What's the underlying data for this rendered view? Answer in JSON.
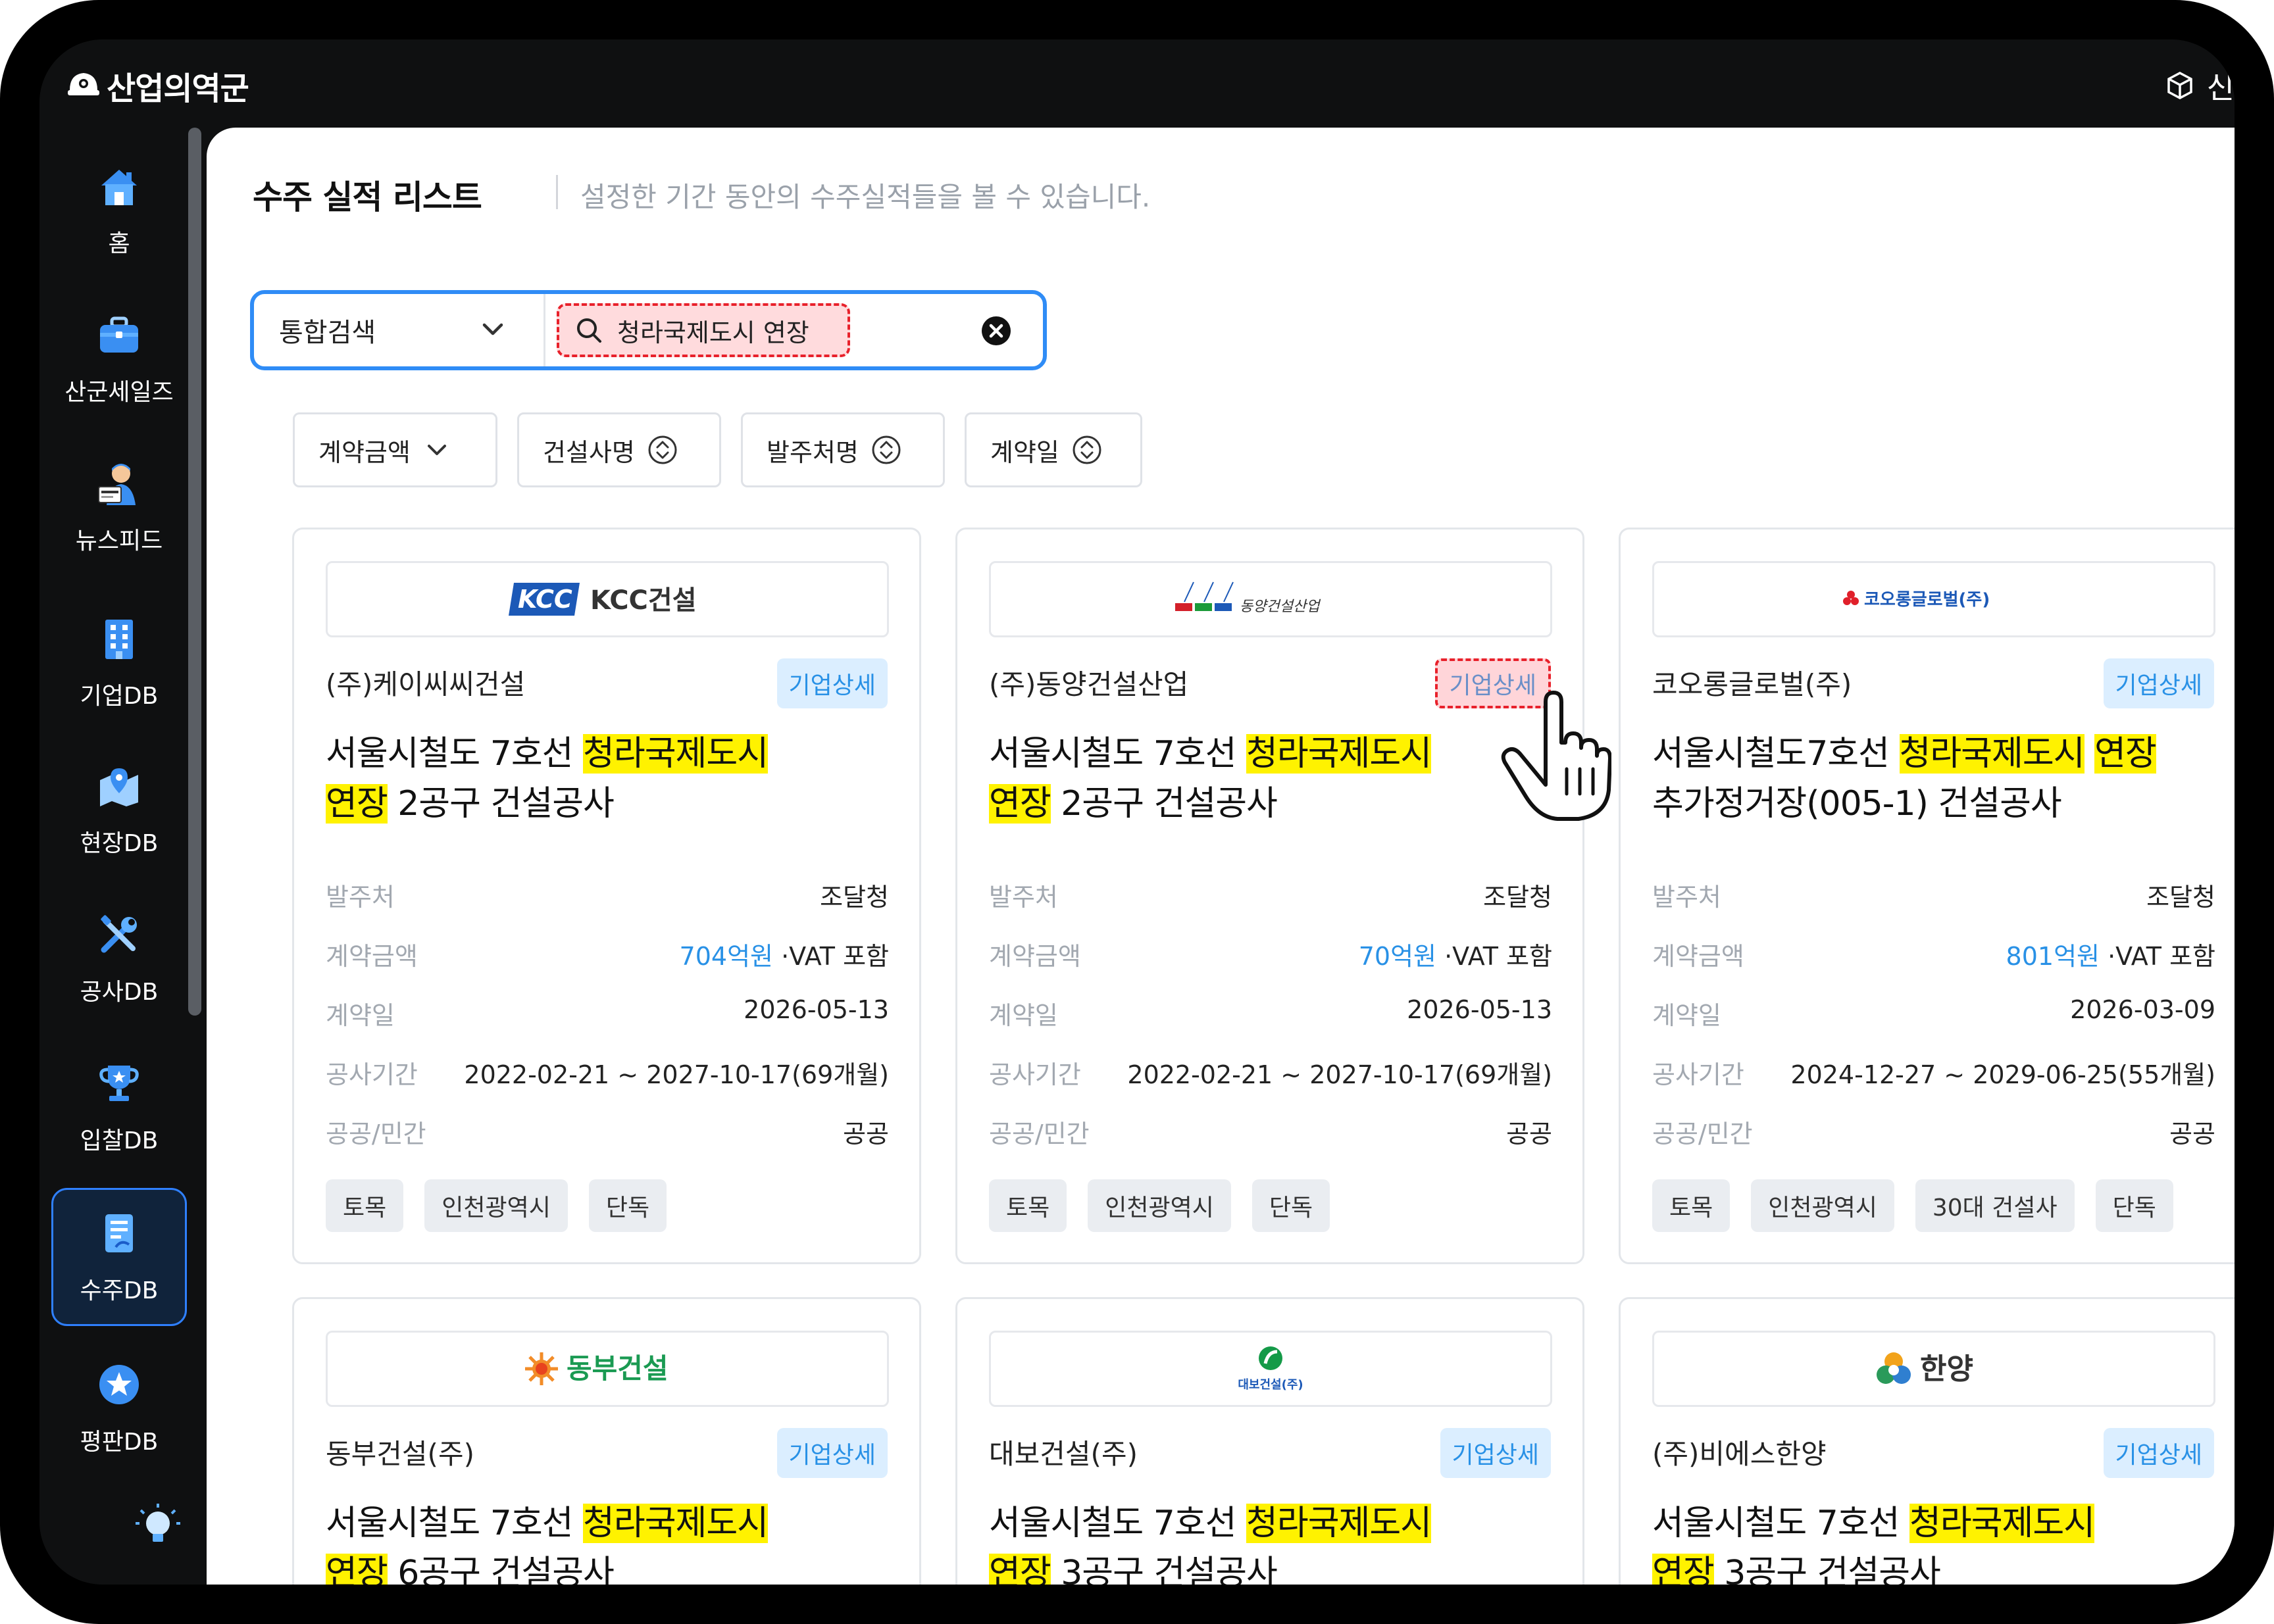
{
  "app": {
    "brand": "산업의역군",
    "top_right_label": "신"
  },
  "sidebar": {
    "items": [
      {
        "label": "홈"
      },
      {
        "label": "산군세일즈"
      },
      {
        "label": "뉴스피드"
      },
      {
        "label": "기업DB"
      },
      {
        "label": "현장DB"
      },
      {
        "label": "공사DB"
      },
      {
        "label": "입찰DB"
      },
      {
        "label": "수주DB",
        "active": true
      },
      {
        "label": "평판DB"
      }
    ]
  },
  "page": {
    "title": "수주 실적 리스트",
    "subtitle": "설정한 기간 동안의 수주실적들을 볼 수 있습니다."
  },
  "search": {
    "scope": "통합검색",
    "query": "청라국제도시 연장"
  },
  "filters": [
    {
      "label": "계약금액",
      "icon": "chevron-down-icon"
    },
    {
      "label": "건설사명",
      "icon": "sort-icon"
    },
    {
      "label": "발주처명",
      "icon": "sort-icon"
    },
    {
      "label": "계약일",
      "icon": "sort-icon"
    }
  ],
  "labels": {
    "client": "발주처",
    "amount": "계약금액",
    "date": "계약일",
    "period": "공사기간",
    "sector": "공공/민간",
    "detail": "기업상세",
    "vat": "·VAT 포함"
  },
  "cards": [
    {
      "logo_text": "KCC건설",
      "company": "(주)케이씨씨건설",
      "project_pre": "서울시철도 7호선 ",
      "project_hl1": "청라국제도시",
      "project_hl2": "연장",
      "project_post": " 2공구 건설공사",
      "client": "조달청",
      "amount": "704억원",
      "date": "2026-05-13",
      "period": "2022-02-21 ~ 2027-10-17(69개월)",
      "sector": "공공",
      "tags": [
        "토목",
        "인천광역시",
        "단독"
      ]
    },
    {
      "logo_text": "동양건설산업",
      "company": "(주)동양건설산업",
      "project_pre": "서울시철도 7호선 ",
      "project_hl1": "청라국제도시",
      "project_hl2": "연장",
      "project_post": " 2공구 건설공사",
      "client": "조달청",
      "amount": "70억원",
      "date": "2026-05-13",
      "period": "2022-02-21 ~ 2027-10-17(69개월)",
      "sector": "공공",
      "tags": [
        "토목",
        "인천광역시",
        "단독"
      ]
    },
    {
      "logo_text": "코오롱글로벌(주)",
      "company": "코오롱글로벌(주)",
      "project_pre": "서울시철도7호선 ",
      "project_hl1": "청라국제도시",
      "project_hl2": "연장",
      "project_post": "추가정거장(005-1) 건설공사",
      "client": "조달청",
      "amount": "801억원",
      "date": "2026-03-09",
      "period": "2024-12-27 ~ 2029-06-25(55개월)",
      "sector": "공공",
      "tags": [
        "토목",
        "인천광역시",
        "30대 건설사",
        "단독"
      ]
    },
    {
      "logo_text": "동부건설",
      "company": "동부건설(주)",
      "project_pre": "서울시철도 7호선 ",
      "project_hl1": "청라국제도시",
      "project_hl2": "연장",
      "project_post": " 6공구 건설공사"
    },
    {
      "logo_text": "대보건설(주)",
      "company": "대보건설(주)",
      "project_pre": "서울시철도 7호선 ",
      "project_hl1": "청라국제도시",
      "project_hl2": "연장",
      "project_post": " 3공구 건설공사"
    },
    {
      "logo_text": "한양",
      "company": "(주)비에스한양",
      "project_pre": "서울시철도 7호선 ",
      "project_hl1": "청라국제도시",
      "project_hl2": "연장",
      "project_post": " 3공구 건설공사"
    }
  ],
  "colors": {
    "accent": "#2f8cf6",
    "highlight": "#fff200",
    "callout_red": "#e8212b",
    "link_blue": "#2991e6"
  }
}
